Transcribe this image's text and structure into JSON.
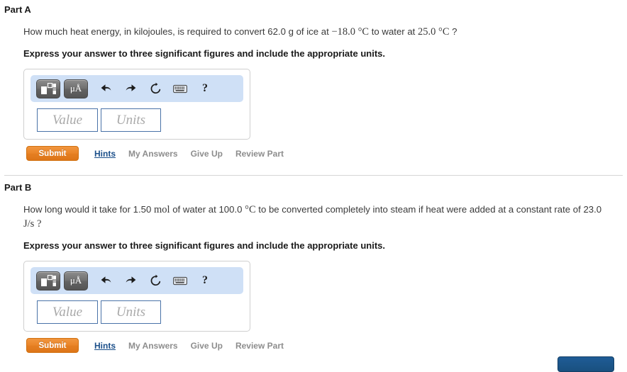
{
  "toolbar_common": {
    "template_button_label": "",
    "units_button_label": "μÅ",
    "help_label": "?",
    "icons": [
      "math-template-icon",
      "units-icon",
      "undo-icon",
      "redo-icon",
      "reset-icon",
      "keyboard-icon",
      "help-icon"
    ]
  },
  "fields_common": {
    "value_placeholder": "Value",
    "units_placeholder": "Units"
  },
  "actions_common": {
    "submit_label": "Submit",
    "hints_label": "Hints",
    "my_answers_label": "My Answers",
    "give_up_label": "Give Up",
    "review_part_label": "Review Part"
  },
  "colors": {
    "toolbar_background": "#cfe0f6",
    "submit_orange": "#ea8427",
    "hints_link_blue": "#1b4f8a",
    "muted_link_gray": "#8d8d8d",
    "field_border_blue": "#4a73a8",
    "next_button_blue": "#1f5c96"
  },
  "partA": {
    "title": "Part A",
    "question_prefix": "How much heat energy, in kilojoules, is required to convert 62.0 g of ice at ",
    "question_temp1": "−18.0 °C",
    "question_middle": " to water at ",
    "question_temp2": "25.0 °C",
    "question_suffix": " ?",
    "instruction": "Express your answer to three significant figures and include the appropriate units."
  },
  "partB": {
    "title": "Part B",
    "question_prefix": "How long would it take for 1.50 ",
    "question_mol": "mol",
    "question_mid1": " of water at 100.0 ",
    "question_temp": "°C",
    "question_mid2": " to be converted completely into steam if heat were added at a constant rate of 23.0 ",
    "question_rate": "J/s",
    "question_suffix": " ?",
    "instruction": "Express your answer to three significant figures and include the appropriate units."
  },
  "footer": {
    "next_button_label": ""
  }
}
